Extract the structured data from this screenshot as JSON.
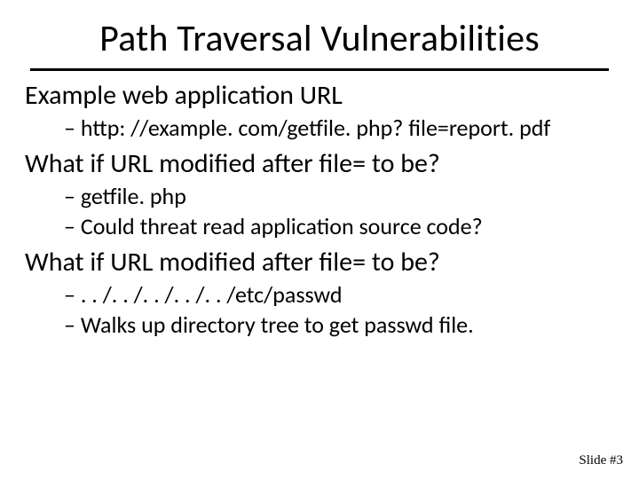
{
  "title": "Path Traversal Vulnerabilities",
  "sections": [
    {
      "heading": "Example web application URL",
      "items": [
        "http: //example. com/getfile. php? file=report. pdf"
      ]
    },
    {
      "heading": "What if URL modified after file= to be?",
      "items": [
        "getfile. php",
        "Could threat read application source code?"
      ]
    },
    {
      "heading": "What if URL modified after file= to be?",
      "items": [
        ". . /. . /. . /. . /. . /etc/passwd",
        "Walks up directory tree to get passwd file."
      ]
    }
  ],
  "footer": "Slide #3"
}
